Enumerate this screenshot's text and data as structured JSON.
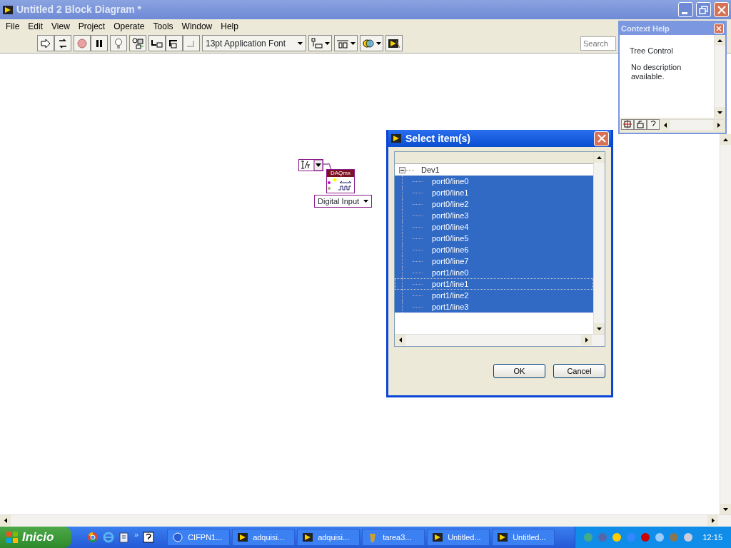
{
  "window": {
    "title": "Untitled 2 Block Diagram *"
  },
  "menu": [
    "File",
    "Edit",
    "View",
    "Project",
    "Operate",
    "Tools",
    "Window",
    "Help"
  ],
  "toolbar": {
    "font": "13pt Application Font",
    "search": {
      "placeholder": "Search"
    }
  },
  "diagram": {
    "node_label": "DAQmx",
    "constant": "Digital Input"
  },
  "context_help": {
    "title": "Context Help",
    "heading": "Tree Control",
    "description": "No description available."
  },
  "dialog": {
    "title": "Select item(s)",
    "tree": {
      "label": "Dev1",
      "expanded": true,
      "children": [
        {
          "label": "port0/line0",
          "selected": true,
          "focused": false
        },
        {
          "label": "port0/line1",
          "selected": true,
          "focused": false
        },
        {
          "label": "port0/line2",
          "selected": true,
          "focused": false
        },
        {
          "label": "port0/line3",
          "selected": true,
          "focused": false
        },
        {
          "label": "port0/line4",
          "selected": true,
          "focused": false
        },
        {
          "label": "port0/line5",
          "selected": true,
          "focused": false
        },
        {
          "label": "port0/line6",
          "selected": true,
          "focused": false
        },
        {
          "label": "port0/line7",
          "selected": true,
          "focused": false
        },
        {
          "label": "port1/line0",
          "selected": true,
          "focused": false
        },
        {
          "label": "port1/line1",
          "selected": true,
          "focused": true
        },
        {
          "label": "port1/line2",
          "selected": true,
          "focused": false
        },
        {
          "label": "port1/line3",
          "selected": true,
          "focused": false
        }
      ]
    },
    "buttons": [
      "OK",
      "Cancel"
    ]
  },
  "taskbar": {
    "start": "Inicio",
    "more": "»",
    "tasks": [
      "CIFPN1...",
      "adquisi...",
      "adquisi...",
      "tarea3...",
      "Untitled...",
      "Untitled..."
    ],
    "clock": "12:15"
  }
}
